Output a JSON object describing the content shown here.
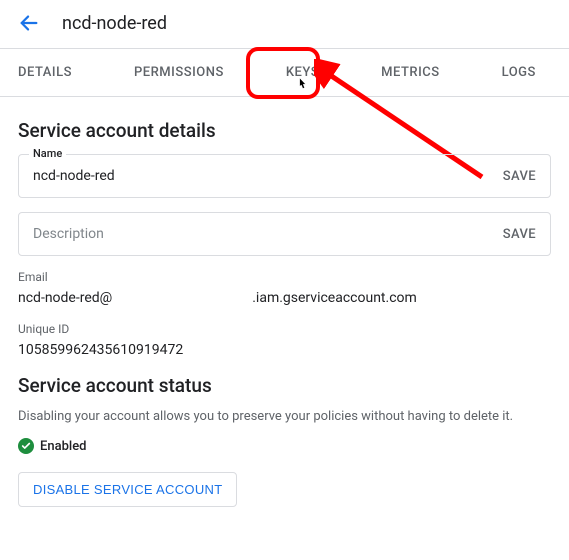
{
  "header": {
    "title": "ncd-node-red"
  },
  "tabs": {
    "items": [
      "DETAILS",
      "PERMISSIONS",
      "KEYS",
      "METRICS",
      "LOGS"
    ],
    "highlighted": "KEYS"
  },
  "details": {
    "section_title": "Service account details",
    "name": {
      "label": "Name",
      "value": "ncd-node-red",
      "save": "SAVE"
    },
    "description": {
      "placeholder": "Description",
      "save": "SAVE"
    },
    "email": {
      "label": "Email",
      "value_prefix": "ncd-node-red@",
      "value_suffix": ".iam.gserviceaccount.com"
    },
    "unique_id": {
      "label": "Unique ID",
      "value": "105859962435610919472"
    }
  },
  "status": {
    "section_title": "Service account status",
    "description": "Disabling your account allows you to preserve your policies without having to delete it.",
    "badge": "Enabled",
    "disable_button": "DISABLE SERVICE ACCOUNT"
  },
  "icons": {
    "back": "back-arrow-icon",
    "cursor": "pointer-cursor-icon",
    "check": "check-circle-icon"
  },
  "annotation": {
    "color": "#ff0000"
  }
}
